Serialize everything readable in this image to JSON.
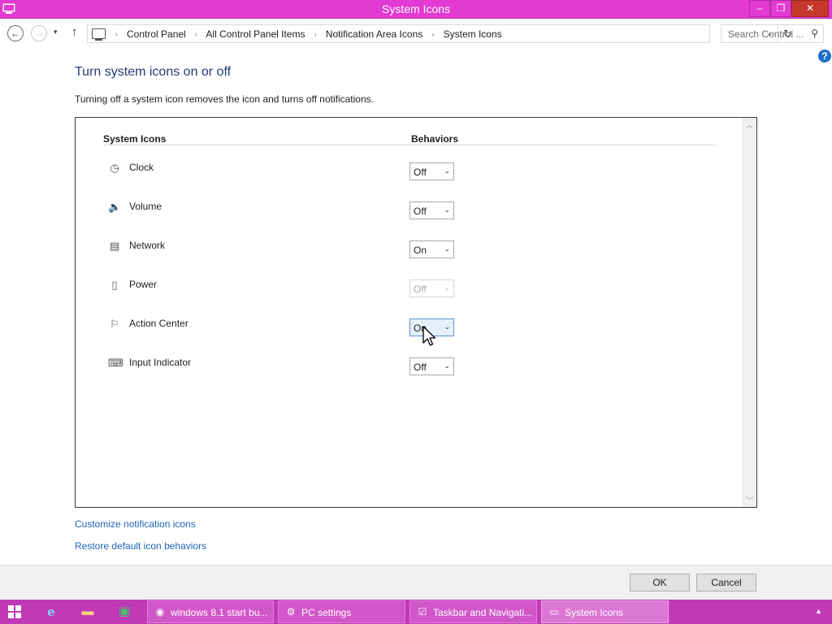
{
  "window": {
    "title": "System Icons",
    "controls": {
      "minimize": "–",
      "maximize": "❐",
      "close": "✕"
    }
  },
  "nav": {
    "back_glyph": "←",
    "forward_glyph": "→",
    "recent_glyph": "▾",
    "up_glyph": "↑",
    "breadcrumbs": [
      "Control Panel",
      "All Control Panel Items",
      "Notification Area Icons",
      "System Icons"
    ],
    "crumb_separator": "›",
    "address_dropdown_glyph": "⌄",
    "refresh_glyph": "↻",
    "search_placeholder": "Search Control ...",
    "search_glyph": "⚲"
  },
  "help_glyph": "?",
  "heading": "Turn system icons on or off",
  "description": "Turning off a system icon removes the icon and turns off notifications.",
  "table": {
    "col_icons": "System Icons",
    "col_behaviors": "Behaviors",
    "rows": [
      {
        "label": "Clock",
        "value": "Off",
        "icon": "clock-icon",
        "glyph": "◷"
      },
      {
        "label": "Volume",
        "value": "Off",
        "icon": "volume-icon",
        "glyph": "🔈"
      },
      {
        "label": "Network",
        "value": "On",
        "icon": "network-icon",
        "glyph": "▤"
      },
      {
        "label": "Power",
        "value": "Off",
        "icon": "power-icon",
        "glyph": "▯"
      },
      {
        "label": "Action Center",
        "value": "On",
        "icon": "flag-icon",
        "glyph": "⚐"
      },
      {
        "label": "Input Indicator",
        "value": "Off",
        "icon": "keyboard-icon",
        "glyph": "⌨"
      }
    ],
    "select_arrow": "⌄",
    "scroll_up": "︿",
    "scroll_down": "﹀"
  },
  "links": {
    "customize": "Customize notification icons",
    "restore": "Restore default icon behaviors"
  },
  "buttons": {
    "ok": "OK",
    "cancel": "Cancel"
  },
  "taskbar": {
    "pinned": [
      {
        "icon": "internet-explorer-icon",
        "glyph": "e"
      },
      {
        "icon": "file-explorer-icon",
        "glyph": "▬"
      },
      {
        "icon": "store-icon",
        "glyph": "▣"
      }
    ],
    "tasks": [
      {
        "label": "windows 8.1 start bu...",
        "icon": "chrome-icon",
        "glyph": "◉"
      },
      {
        "label": "PC settings",
        "icon": "gear-icon",
        "glyph": "⚙"
      },
      {
        "label": "Taskbar and Navigati...",
        "icon": "checklist-icon",
        "glyph": "☑"
      },
      {
        "label": "System Icons",
        "icon": "control-panel-icon",
        "glyph": "▭"
      }
    ],
    "tray_glyph": "▲"
  },
  "colors": {
    "titlebar": "#e23ad2",
    "taskbar": "#c03ab6",
    "heading": "#1f3d73",
    "link": "#1e63b5"
  }
}
